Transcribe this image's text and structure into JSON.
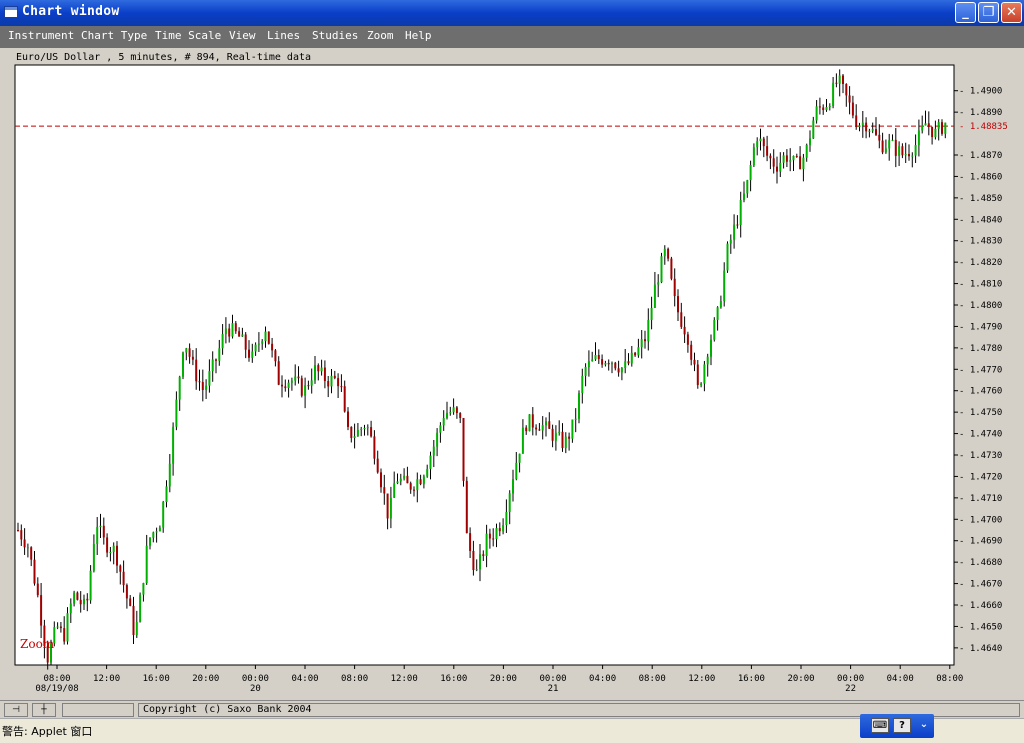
{
  "window": {
    "title": "Chart window",
    "minimize_glyph": "_",
    "maximize_glyph": "❐",
    "close_glyph": "✕"
  },
  "menu": {
    "items": [
      {
        "label": "Instrument"
      },
      {
        "label": "Chart Type"
      },
      {
        "label": "Time Scale"
      },
      {
        "label": "View"
      },
      {
        "label": "Lines"
      },
      {
        "label": "Studies"
      },
      {
        "label": "Zoom"
      },
      {
        "label": "Help"
      }
    ]
  },
  "chart_header": "Euro/US Dollar , 5 minutes, # 894, Real-time data",
  "chart_data": {
    "type": "candlestick",
    "instrument": "Euro/US Dollar",
    "interval": "5 minutes",
    "bar_count": "894",
    "ylim": [
      1.4632,
      1.4912
    ],
    "yticks": [
      "1.4900",
      "1.4890",
      "1.4870",
      "1.4860",
      "1.4850",
      "1.4840",
      "1.4830",
      "1.4820",
      "1.4810",
      "1.4800",
      "1.4790",
      "1.4780",
      "1.4770",
      "1.4760",
      "1.4750",
      "1.4740",
      "1.4730",
      "1.4720",
      "1.4710",
      "1.4700",
      "1.4690",
      "1.4680",
      "1.4670",
      "1.4660",
      "1.4650",
      "1.4640"
    ],
    "current_price": "1.48835",
    "current_price_value": 1.48835,
    "xticks": [
      "08:00",
      "12:00",
      "16:00",
      "20:00",
      "00:00",
      "04:00",
      "08:00",
      "12:00",
      "16:00",
      "20:00",
      "00:00",
      "04:00",
      "08:00",
      "12:00",
      "16:00",
      "20:00",
      "00:00",
      "04:00",
      "08:00"
    ],
    "date_labels": [
      "08/19/08",
      "20",
      "21",
      "22"
    ],
    "price_path": [
      [
        0,
        1.4695
      ],
      [
        3,
        1.4688
      ],
      [
        6,
        1.4665
      ],
      [
        9,
        1.4635
      ],
      [
        12,
        1.465
      ],
      [
        14,
        1.4645
      ],
      [
        17,
        1.4665
      ],
      [
        21,
        1.4658
      ],
      [
        24,
        1.47
      ],
      [
        26,
        1.469
      ],
      [
        30,
        1.4685
      ],
      [
        34,
        1.466
      ],
      [
        36,
        1.4645
      ],
      [
        40,
        1.469
      ],
      [
        44,
        1.47
      ],
      [
        48,
        1.4745
      ],
      [
        51,
        1.4785
      ],
      [
        54,
        1.477
      ],
      [
        57,
        1.476
      ],
      [
        61,
        1.4775
      ],
      [
        64,
        1.479
      ],
      [
        68,
        1.4785
      ],
      [
        72,
        1.4775
      ],
      [
        76,
        1.479
      ],
      [
        80,
        1.4765
      ],
      [
        84,
        1.4765
      ],
      [
        88,
        1.476
      ],
      [
        91,
        1.477
      ],
      [
        95,
        1.4765
      ],
      [
        99,
        1.4765
      ],
      [
        101,
        1.474
      ],
      [
        104,
        1.474
      ],
      [
        107,
        1.4745
      ],
      [
        110,
        1.473
      ],
      [
        114,
        1.47
      ],
      [
        116,
        1.472
      ],
      [
        120,
        1.4715
      ],
      [
        124,
        1.472
      ],
      [
        128,
        1.4735
      ],
      [
        131,
        1.475
      ],
      [
        134,
        1.475
      ],
      [
        136,
        1.4745
      ],
      [
        138,
        1.469
      ],
      [
        141,
        1.4675
      ],
      [
        144,
        1.469
      ],
      [
        147,
        1.4695
      ],
      [
        149,
        1.47
      ],
      [
        152,
        1.472
      ],
      [
        156,
        1.4745
      ],
      [
        160,
        1.4745
      ],
      [
        164,
        1.474
      ],
      [
        168,
        1.4735
      ],
      [
        171,
        1.4745
      ],
      [
        174,
        1.477
      ],
      [
        178,
        1.4775
      ],
      [
        182,
        1.4775
      ],
      [
        186,
        1.477
      ],
      [
        189,
        1.4775
      ],
      [
        193,
        1.4785
      ],
      [
        196,
        1.481
      ],
      [
        199,
        1.4825
      ],
      [
        202,
        1.48
      ],
      [
        206,
        1.4785
      ],
      [
        209,
        1.476
      ],
      [
        212,
        1.478
      ],
      [
        215,
        1.4795
      ],
      [
        218,
        1.4825
      ],
      [
        221,
        1.484
      ],
      [
        224,
        1.4855
      ],
      [
        227,
        1.488
      ],
      [
        230,
        1.487
      ],
      [
        233,
        1.4865
      ],
      [
        236,
        1.487
      ],
      [
        239,
        1.4865
      ],
      [
        242,
        1.487
      ],
      [
        245,
        1.489
      ],
      [
        249,
        1.4895
      ],
      [
        252,
        1.4905
      ],
      [
        255,
        1.4895
      ],
      [
        258,
        1.4885
      ],
      [
        261,
        1.4885
      ],
      [
        265,
        1.4875
      ],
      [
        268,
        1.4875
      ],
      [
        272,
        1.487
      ],
      [
        276,
        1.4875
      ],
      [
        279,
        1.4885
      ],
      [
        282,
        1.488
      ],
      [
        285,
        1.4885
      ]
    ]
  },
  "chart_labels": {
    "zoom_overlay": "Zoom"
  },
  "colors": {
    "up": "#00b000",
    "down": "#a00000",
    "wick": "#000000",
    "price_line": "#c00000",
    "zoom_text": "#c80000"
  },
  "bottom": {
    "tool1_glyph": "⊣",
    "tool2_glyph": "┼",
    "copyright": "Copyright (c) Saxo Bank 2004"
  },
  "status": {
    "text": "警告: Applet 窗口"
  },
  "ime": {
    "keyboard_glyph": "⌨",
    "help_glyph": "?",
    "arrow_glyph": "⌄"
  }
}
